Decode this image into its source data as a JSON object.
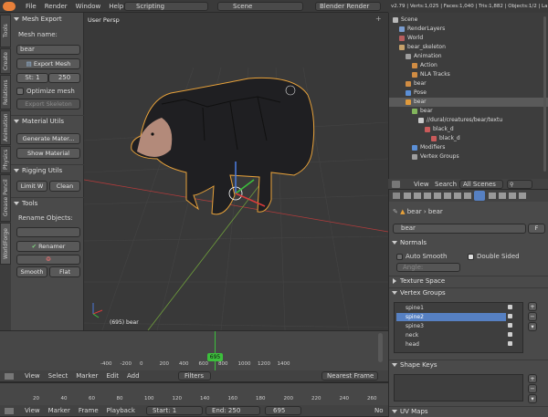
{
  "topbar": {
    "menus": [
      "File",
      "Render",
      "Window",
      "Help"
    ],
    "layout": "Scripting",
    "scene": "Scene",
    "engine": "Blender Render",
    "stats": "v2.79 | Verts:1,025 | Faces:1,040 | Tris:1,882 | Objects:1/2 | La"
  },
  "tabs": [
    "Tools",
    "Create",
    "Relations",
    "Animation",
    "Physics",
    "Grease Pencil",
    "WorldForge"
  ],
  "toolshelf": {
    "mesh_export": "Mesh Export",
    "mesh_name_label": "Mesh name:",
    "mesh_name": "bear",
    "export_mesh": "Export Mesh",
    "st_label": "St: 1",
    "st_value": "250",
    "optimize": "Optimize mesh",
    "export_skeleton": "Export Skeleton",
    "material_utils": "Material Utils",
    "generate": "Generate Mater...",
    "show_material": "Show Material",
    "rigging_utils": "Rigging Utils",
    "limit_w": "Limit W",
    "clean": "Clean",
    "tools": "Tools",
    "rename_objects": "Rename Objects:",
    "renamer": "Renamer",
    "smooth": "Smooth",
    "flat": "Flat"
  },
  "viewport": {
    "label": "User Persp",
    "object": "(695) bear"
  },
  "outliner": {
    "rows": [
      {
        "indent": 0,
        "label": "Scene",
        "color": "#b9b9b9"
      },
      {
        "indent": 1,
        "label": "RenderLayers",
        "color": "#7a9ccf"
      },
      {
        "indent": 1,
        "label": "World",
        "color": "#b75d5d"
      },
      {
        "indent": 1,
        "label": "bear_skeleton",
        "color": "#c7a26a"
      },
      {
        "indent": 2,
        "label": "Animation",
        "color": "#9e9e9e"
      },
      {
        "indent": 3,
        "label": "Action",
        "color": "#d08c43"
      },
      {
        "indent": 3,
        "label": "NLA Tracks",
        "color": "#d08c43"
      },
      {
        "indent": 2,
        "label": "bear",
        "color": "#d08c43"
      },
      {
        "indent": 2,
        "label": "Pose",
        "color": "#5b8fd6"
      },
      {
        "indent": 2,
        "label": "bear",
        "color": "#e09a3c"
      },
      {
        "indent": 3,
        "label": "bear",
        "color": "#82b55c"
      },
      {
        "indent": 4,
        "label": "//dural/creatures/bear/textu",
        "color": "#c9c9c9"
      },
      {
        "indent": 5,
        "label": "black_d",
        "color": "#c95a5a"
      },
      {
        "indent": 6,
        "label": "black_d",
        "color": "#c95a5a"
      },
      {
        "indent": 3,
        "label": "Modifiers",
        "color": "#5b8fd6"
      },
      {
        "indent": 3,
        "label": "Vertex Groups",
        "color": "#9e9e9e"
      }
    ]
  },
  "outliner_header": {
    "view": "View",
    "search": "Search",
    "scenes": "All Scenes"
  },
  "properties": {
    "breadcrumb": [
      "bear",
      "bear"
    ],
    "mesh": "bear",
    "fake": "F",
    "normals": "Normals",
    "auto_smooth": "Auto Smooth",
    "double_sided": "Double Sided",
    "angle": "Angle:",
    "texture_space": "Texture Space",
    "vertex_groups": "Vertex Groups",
    "groups": [
      "spine1",
      "spine2",
      "spine3",
      "neck",
      "head"
    ],
    "shape_keys": "Shape Keys",
    "uv_maps": "UV Maps"
  },
  "timeline": {
    "ticks": [
      "-400",
      "-200",
      "0",
      "200",
      "400",
      "600",
      "800",
      "1000",
      "1200",
      "1400"
    ],
    "frame": "695",
    "menus": [
      "View",
      "Select",
      "Marker",
      "Edit",
      "Add"
    ],
    "filters": "Filters",
    "nearest": "Nearest Frame",
    "ruler": [
      "20",
      "40",
      "60",
      "80",
      "100",
      "120",
      "140",
      "160",
      "180",
      "200",
      "220",
      "240",
      "260"
    ],
    "bottom_menus": [
      "View",
      "Marker",
      "Frame",
      "Playback"
    ],
    "start": "Start:",
    "start_val": "1",
    "end": "End:",
    "end_val": "250",
    "cur": "695",
    "no": "No"
  },
  "colors": {
    "accent": "#5680c2",
    "selection_orange": "#e8a23a",
    "frame_green": "#3cbf3c"
  }
}
